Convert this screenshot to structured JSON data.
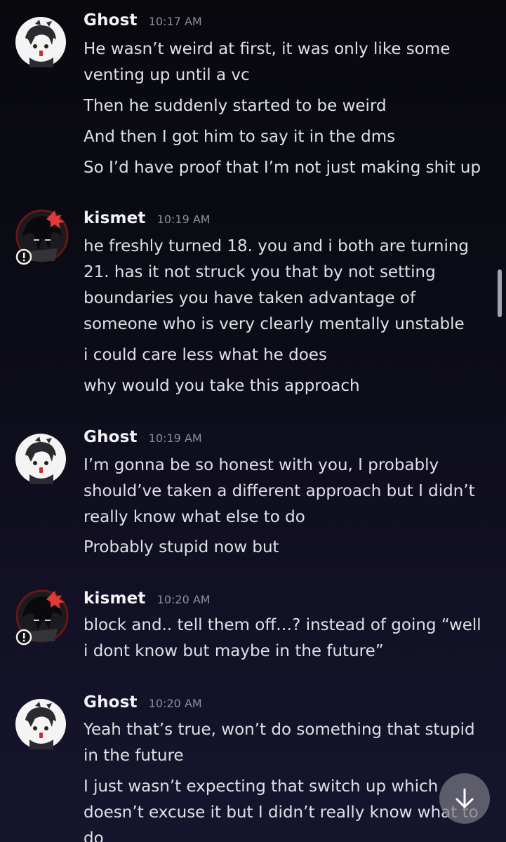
{
  "messages": [
    {
      "author": "Ghost",
      "time": "10:17 AM",
      "avatar_icon": "ghost-avatar-icon",
      "lines": [
        "He wasn’t weird at first, it was only like some",
        "venting up until a vc",
        "Then he suddenly started to be weird",
        "And then I got him to say it in the dms",
        "So I’d have proof that I’m not just making shit up"
      ]
    },
    {
      "author": "kismet",
      "time": "10:19 AM",
      "avatar_icon": "kismet-avatar-icon",
      "lines": [
        "he freshly turned 18. you and i both are turning",
        "21. has it not struck you that by not setting",
        "boundaries you have taken advantage of",
        "someone who is very clearly mentally unstable",
        "i could care less what he does",
        "why would you take this approach"
      ]
    },
    {
      "author": "Ghost",
      "time": "10:19 AM",
      "avatar_icon": "ghost-avatar-icon",
      "lines": [
        "I’m gonna be so honest with you, I probably",
        "should’ve taken a different approach but I didn’t",
        "really know what else to do",
        "Probably stupid now but"
      ]
    },
    {
      "author": "kismet",
      "time": "10:20 AM",
      "avatar_icon": "kismet-avatar-icon",
      "lines": [
        "block and.. tell them off…? instead of going “well",
        "i dont know but maybe in the future”"
      ]
    },
    {
      "author": "Ghost",
      "time": "10:20 AM",
      "avatar_icon": "ghost-avatar-icon",
      "lines": [
        "Yeah that’s true, won’t do something that stupid",
        "in the future",
        "I just wasn’t expecting that switch up which",
        "doesn’t excuse it but I didn’t really know what to",
        "do"
      ]
    }
  ],
  "jump_button_icon": "arrow-down-icon",
  "colors": {
    "background": "#0c0c17",
    "username": "#f2f3f5",
    "timestamp": "#8d8f99",
    "message_text": "#dfe0e6",
    "status_indicator": "#f0f0f0",
    "anger_mark": "#e03a3a"
  }
}
